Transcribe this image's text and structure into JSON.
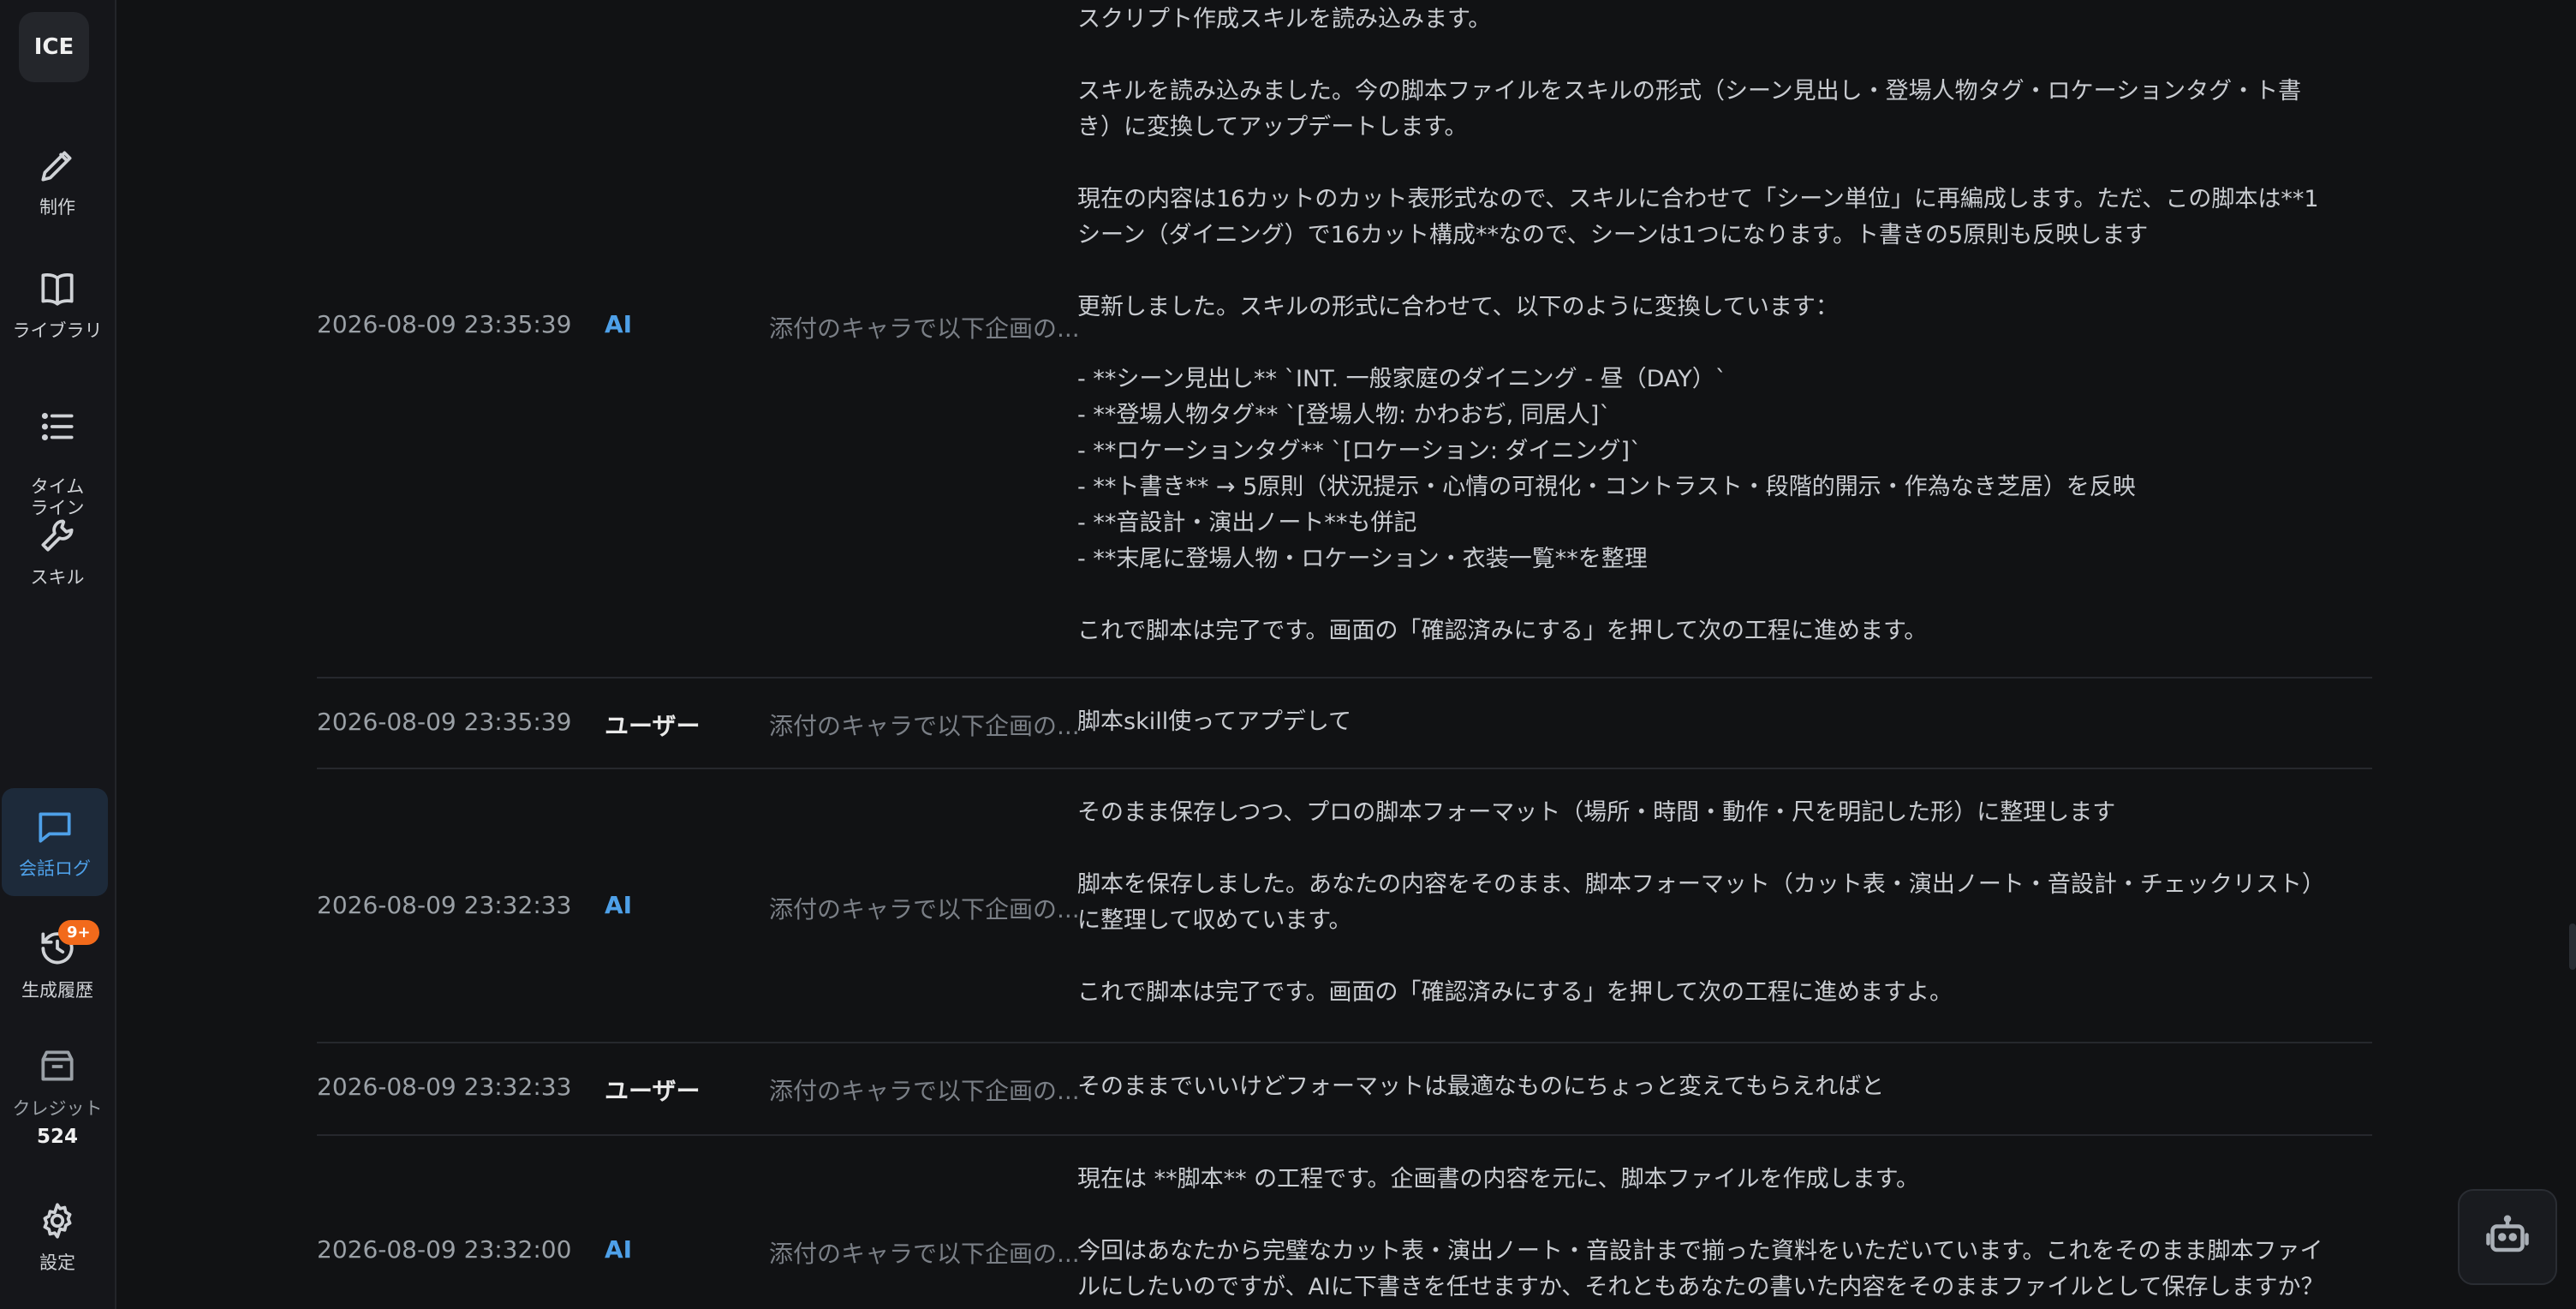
{
  "sidebar": {
    "logo": "ICE",
    "items": [
      {
        "label": "制作",
        "icon": "pencil-icon"
      },
      {
        "label": "ライブラリ",
        "icon": "book-icon"
      },
      {
        "label": "タイム\nライン",
        "icon": "list-icon"
      },
      {
        "label": "スキル",
        "icon": "wrench-icon"
      },
      {
        "label": "会話ログ",
        "icon": "chat-icon"
      },
      {
        "label": "生成履歴",
        "icon": "history-icon",
        "badge": "9+"
      },
      {
        "label": "クレジット",
        "icon": "credit-box-icon",
        "value": "524"
      },
      {
        "label": "設定",
        "icon": "gear-icon"
      }
    ],
    "active": "会話ログ"
  },
  "log": {
    "rows": [
      {
        "time": "2026-08-09 23:35:39",
        "role": "AI",
        "subject": "添付のキャラで以下企画の...",
        "message": "スクリプト作成スキルを読み込みます。\n\nスキルを読み込みました。今の脚本ファイルをスキルの形式（シーン見出し・登場人物タグ・ロケーションタグ・ト書\nき）に変換してアップデートします。\n\n現在の内容は16カットのカット表形式なので、スキルに合わせて「シーン単位」に再編成します。ただ、この脚本は**1\nシーン（ダイニング）で16カット構成**なので、シーンは1つになります。ト書きの5原則も反映します\n\n更新しました。スキルの形式に合わせて、以下のように変換しています：\n\n- **シーン見出し** `INT. 一般家庭のダイニング - 昼（DAY）`\n- **登場人物タグ** `[登場人物: かわおぢ, 同居人]`\n- **ロケーションタグ** `[ロケーション: ダイニング]`\n- **ト書き** → 5原則（状況提示・心情の可視化・コントラスト・段階的開示・作為なき芝居）を反映\n- **音設計・演出ノート**も併記\n- **末尾に登場人物・ロケーション・衣装一覧**を整理\n\nこれで脚本は完了です。画面の「確認済みにする」を押して次の工程に進めます。"
      },
      {
        "time": "2026-08-09 23:35:39",
        "role": "ユーザー",
        "subject": "添付のキャラで以下企画の...",
        "message": "脚本skill使ってアプデして"
      },
      {
        "time": "2026-08-09 23:32:33",
        "role": "AI",
        "subject": "添付のキャラで以下企画の...",
        "message": "そのまま保存しつつ、プロの脚本フォーマット（場所・時間・動作・尺を明記した形）に整理します\n\n脚本を保存しました。あなたの内容をそのまま、脚本フォーマット（カット表・演出ノート・音設計・チェックリスト）\nに整理して収めています。\n\nこれで脚本は完了です。画面の「確認済みにする」を押して次の工程に進めますよ。"
      },
      {
        "time": "2026-08-09 23:32:33",
        "role": "ユーザー",
        "subject": "添付のキャラで以下企画の...",
        "message": "そのままでいいけどフォーマットは最適なものにちょっと変えてもらえればと"
      },
      {
        "time": "2026-08-09 23:32:00",
        "role": "AI",
        "subject": "添付のキャラで以下企画の...",
        "message": "現在は **脚本** の工程です。企画書の内容を元に、脚本ファイルを作成します。\n\n今回はあなたから完璧なカット表・演出ノート・音設計まで揃った資料をいただいています。これをそのまま脚本ファイ\nルにしたいのですが、AIに下書きを任せますか、それともあなたの書いた内容をそのままファイルとして保存しますか？"
      }
    ]
  },
  "colors": {
    "background": "#111214",
    "sidebar": "#15161a",
    "accent": "#4ea0e8",
    "badge": "#f26a1b"
  },
  "floating": {
    "icon": "robot-icon"
  }
}
